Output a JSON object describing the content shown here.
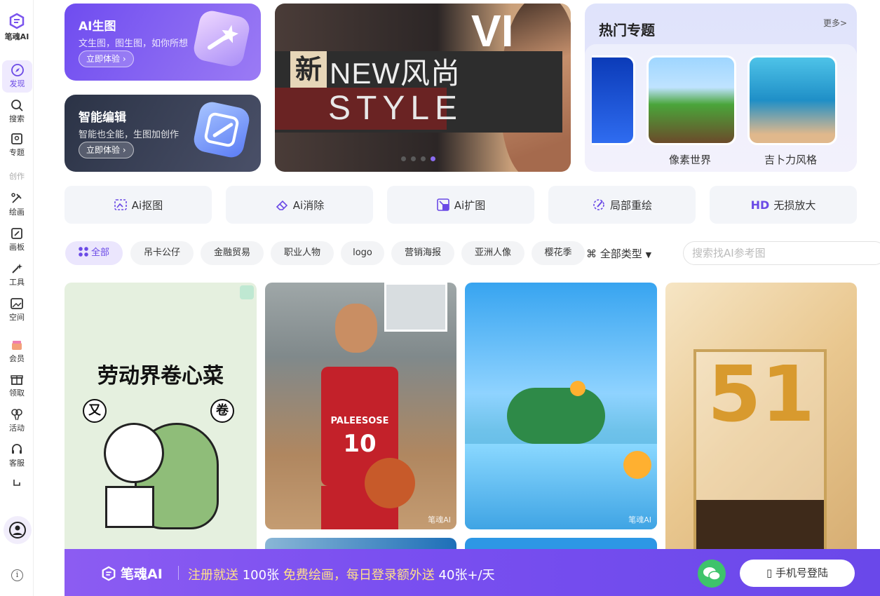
{
  "brand": {
    "name": "笔魂AI"
  },
  "sidebar": {
    "items": [
      {
        "label": "发现"
      },
      {
        "label": "搜索"
      },
      {
        "label": "专题"
      },
      {
        "label": "创作"
      },
      {
        "label": "绘画"
      },
      {
        "label": "画板"
      },
      {
        "label": "工具"
      },
      {
        "label": "空间"
      },
      {
        "label": "会员"
      },
      {
        "label": "领取"
      },
      {
        "label": "活动"
      },
      {
        "label": "客服"
      }
    ],
    "info_glyph": "i"
  },
  "promo_cards": [
    {
      "title": "AI生图",
      "subtitle": "文生图，图生图，如你所想",
      "cta": "立即体验 ›"
    },
    {
      "title": "智能编辑",
      "subtitle": "智能也全能，生图加创作",
      "cta": "立即体验 ›"
    }
  ],
  "banner": {
    "text_new": "NEW风尚",
    "text_xin": "新",
    "text_style": "STYLE",
    "text_vi": "VI",
    "active_slide": 4,
    "total_slides": 4
  },
  "topics": {
    "title": "热门专题",
    "more": "更多>",
    "items": [
      {
        "label": ""
      },
      {
        "label": "像素世界"
      },
      {
        "label": "吉卜力风格"
      }
    ]
  },
  "tools": [
    {
      "label": "Ai抠图"
    },
    {
      "label": "Ai消除"
    },
    {
      "label": "Ai扩图"
    },
    {
      "label": "局部重绘"
    },
    {
      "label": "无损放大",
      "prefix": "HD"
    }
  ],
  "filters": {
    "chips": [
      "全部",
      "吊卡公仔",
      "金融贸易",
      "职业人物",
      "logo",
      "营销海报",
      "亚洲人像",
      "樱花季"
    ],
    "type_label": "全部类型",
    "search_placeholder": "搜索找AI参考图"
  },
  "gallery": {
    "items": [
      {
        "caption": "劳动界卷心菜",
        "badges": [
          "又",
          "卷"
        ]
      },
      {
        "jersey_text": "PALEESOSE",
        "jersey_number": "10",
        "watermark": "笔魂AI"
      },
      {
        "watermark": "笔魂AI"
      },
      {
        "sign_text": "51"
      }
    ]
  },
  "promo_bar": {
    "brand": "笔魂AI",
    "msg_a": "注册就送 ",
    "msg_b": "100张",
    "msg_c": " 免费绘画，每日登录额外送 ",
    "msg_d": "40张+/天",
    "login": "手机号登陆"
  },
  "colors": {
    "accent": "#7a54ee",
    "promo_text": "#ffe08a"
  }
}
